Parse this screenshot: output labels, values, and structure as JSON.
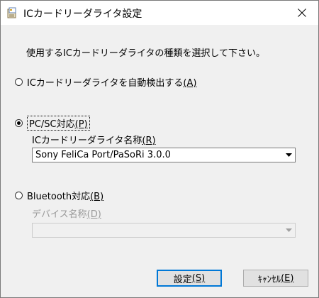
{
  "window": {
    "title": "ICカードリーダライタ設定",
    "close_icon": "close-icon",
    "app_icon": "card-reader-app-icon"
  },
  "instruction": "使用するICカードリーダライタの種類を選択して下さい。",
  "options": {
    "auto": {
      "label": "ICカードリーダライタを自動検出する",
      "mnemonic": "(A)",
      "selected": false
    },
    "pcsc": {
      "label": "PC/SC対応",
      "mnemonic": "(P)",
      "selected": true,
      "field_label": "ICカードリーダライタ名称",
      "field_mnemonic": "(R)",
      "value": "Sony FeliCa Port/PaSoRi 3.0.0"
    },
    "bluetooth": {
      "label": "Bluetooth対応",
      "mnemonic": "(B)",
      "selected": false,
      "field_label": "デバイス名称",
      "field_mnemonic": "(D)",
      "value": "",
      "enabled": false
    }
  },
  "buttons": {
    "ok": {
      "label": "設定",
      "mnemonic": "(S)"
    },
    "cancel": {
      "label": "ｷｬﾝｾﾙ",
      "mnemonic": "(E)"
    }
  },
  "colors": {
    "focus_border": "#0078d7",
    "disabled_text": "#9a9a9a",
    "dialog_bg": "#f0f0f0"
  }
}
